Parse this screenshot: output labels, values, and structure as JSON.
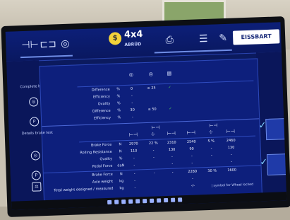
{
  "toolbar": {
    "items": [
      "brake-tester",
      "axle-load",
      "wheel-check",
      "4x4",
      "printer",
      "report",
      "edit",
      "document"
    ],
    "mode_label": "4x4",
    "mode_sub": "ABRÜD",
    "brand": "EISSBART"
  },
  "overall": {
    "title": "Complete brake test",
    "columns": [
      "",
      "≤ 25",
      ""
    ],
    "rows": [
      {
        "label": "Difference",
        "unit": "%",
        "values": [
          "0",
          "≤ 25",
          "✓"
        ]
      },
      {
        "label": "Efficiency",
        "unit": "%",
        "values": [
          "-",
          "",
          ""
        ]
      },
      {
        "label": "Ovality",
        "unit": "%",
        "values": [
          "-",
          "",
          ""
        ]
      },
      {
        "label": "Difference",
        "unit": "%",
        "values": [
          "30",
          "≤ 50",
          "✓"
        ]
      },
      {
        "label": "Efficiency",
        "unit": "%",
        "values": [
          "-",
          "",
          ""
        ]
      }
    ]
  },
  "details": {
    "title": "Details brake test",
    "rows": [
      {
        "label": "Brake Force",
        "unit": "N",
        "values": [
          "2970",
          "22 %",
          "2310",
          "2540",
          "5 %",
          "2460"
        ]
      },
      {
        "label": "Rolling Resistance",
        "unit": "N",
        "values": [
          "110",
          "-",
          "130",
          "90",
          "-",
          "130"
        ]
      },
      {
        "label": "Ovality",
        "unit": "%",
        "values": [
          "-",
          "-",
          "-",
          "-",
          "-",
          "-"
        ]
      },
      {
        "label": "Pedal Force",
        "unit": "daN",
        "values": [
          "-",
          "",
          "-",
          "-",
          "",
          "-"
        ]
      },
      {
        "label": "Brake Force",
        "unit": "N",
        "values": [
          "-",
          "-",
          "-",
          "2280",
          "30 %",
          "1600"
        ]
      },
      {
        "label": "Axle weight",
        "unit": "kg",
        "values": [
          "-",
          "",
          "",
          "-",
          "",
          ""
        ]
      },
      {
        "label": "Total weight designed / measured",
        "unit": "kg",
        "values": [
          "-",
          "",
          "",
          "-/-",
          "",
          ""
        ]
      }
    ],
    "footnote": "| symbol for Wheel locked"
  },
  "taskbar_icons": 11
}
